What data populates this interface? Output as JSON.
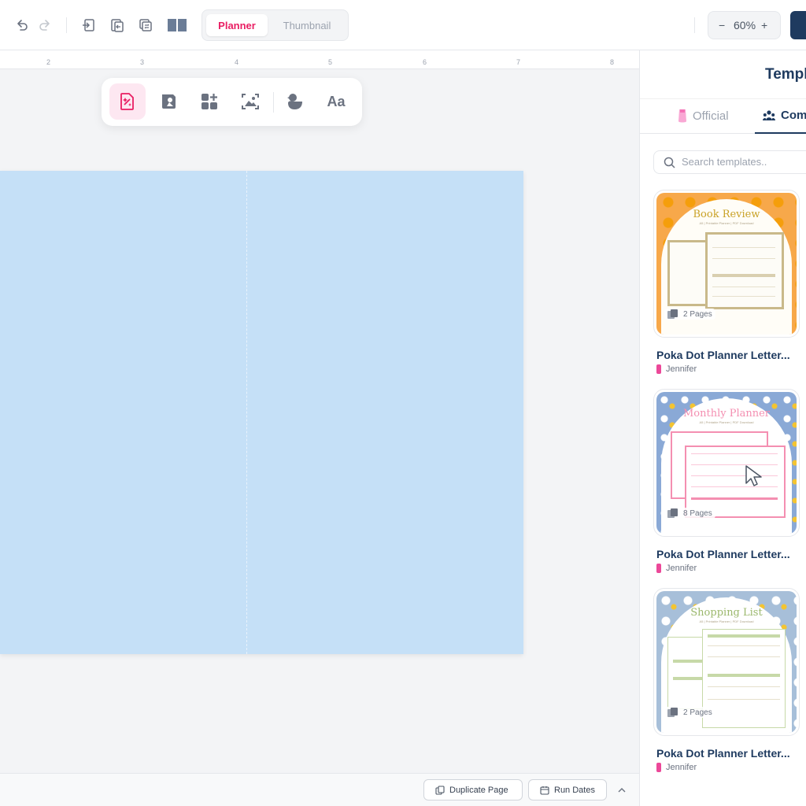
{
  "toolbar": {
    "icons": [
      "undo-icon",
      "redo-icon",
      "import-page-icon",
      "export-page-icon",
      "swap-pages-icon",
      "layout-split-icon"
    ],
    "view_tabs": {
      "active": "Planner",
      "inactive": "Thumbnail"
    },
    "zoom": {
      "minus": "−",
      "value": "60%",
      "plus": "+"
    }
  },
  "ruler": {
    "marks": [
      "2",
      "3",
      "4",
      "5",
      "6",
      "7",
      "8"
    ]
  },
  "floating_tools": [
    "ai-design-icon",
    "sticker-icon",
    "elements-icon",
    "image-icon",
    "duck-icon",
    "Aa"
  ],
  "bottom_bar": {
    "duplicate_label": "Duplicate Page",
    "run_dates_label": "Run Dates"
  },
  "panel": {
    "title": "Templ",
    "tabs": {
      "official": "Official",
      "community": "Com"
    },
    "search_placeholder": "Search templates..",
    "cards": [
      {
        "thumb_title": "Book Review",
        "thumb_sub": "A5 | Printable Planner | PDF Download",
        "pages": "2 Pages",
        "name": "Poka Dot Planner Letter...",
        "author": "Jennifer",
        "theme": "orange"
      },
      {
        "thumb_title": "Monthly Planner",
        "thumb_sub": "A5 | Printable Planner | PDF Download",
        "pages": "8 Pages",
        "name": "Poka Dot Planner Letter...",
        "author": "Jennifer",
        "theme": "blue"
      },
      {
        "thumb_title": "Shopping List",
        "thumb_sub": "A5 | Printable Planner | PDF Download",
        "pages": "2 Pages",
        "name": "Poka Dot Planner Letter...",
        "author": "Jennifer",
        "theme": "green"
      }
    ]
  },
  "colors": {
    "accent": "#e91e63",
    "navy": "#1e3a5f",
    "page": "#c5e0f7"
  }
}
